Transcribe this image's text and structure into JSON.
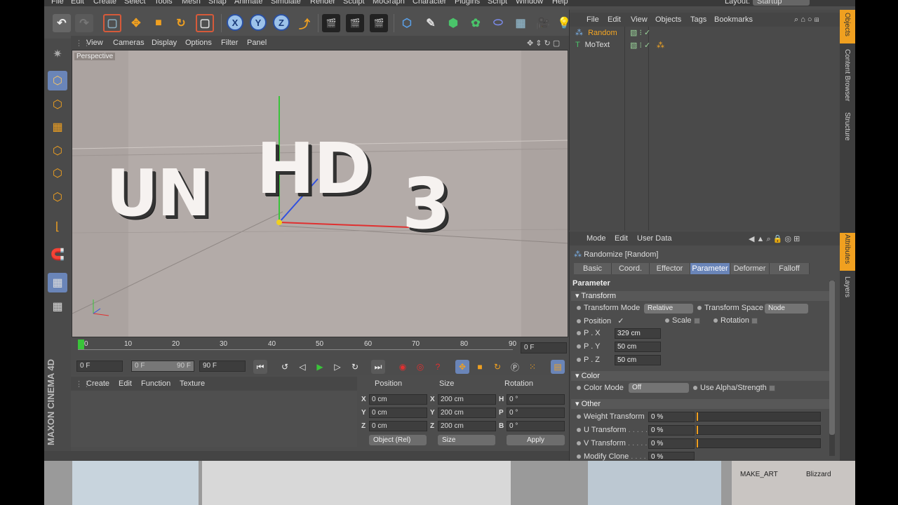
{
  "menubar": [
    "File",
    "Edit",
    "Create",
    "Select",
    "Tools",
    "Mesh",
    "Snap",
    "Animate",
    "Simulate",
    "Render",
    "Sculpt",
    "MoGraph",
    "Character",
    "Plugins",
    "Script",
    "Window",
    "Help"
  ],
  "layout": {
    "label": "Layout:",
    "value": "Startup"
  },
  "toolbar": {
    "axis_x": "X",
    "axis_y": "Y",
    "axis_z": "Z"
  },
  "viewport": {
    "menu": [
      "View",
      "Cameras",
      "Display",
      "Options",
      "Filter",
      "Panel"
    ],
    "label": "Perspective",
    "text_objects": [
      "UN",
      "HD",
      "3"
    ]
  },
  "timeline": {
    "ticks": [
      "0",
      "10",
      "20",
      "30",
      "40",
      "50",
      "60",
      "70",
      "80",
      "90"
    ],
    "current_frame": "0 F"
  },
  "transport": {
    "start_field": "0 F",
    "preview_min": "0 F",
    "preview_max": "90 F",
    "end_field": "90 F"
  },
  "material_manager": {
    "menu": [
      "Create",
      "Edit",
      "Function",
      "Texture"
    ]
  },
  "coordinates": {
    "headers": {
      "position": "Position",
      "size": "Size",
      "rotation": "Rotation"
    },
    "rows": [
      {
        "axis": "X",
        "pos": "0 cm",
        "size_axis": "X",
        "size": "200 cm",
        "rot_axis": "H",
        "rot": "0 °"
      },
      {
        "axis": "Y",
        "pos": "0 cm",
        "size_axis": "Y",
        "size": "200 cm",
        "rot_axis": "P",
        "rot": "0 °"
      },
      {
        "axis": "Z",
        "pos": "0 cm",
        "size_axis": "Z",
        "size": "200 cm",
        "rot_axis": "B",
        "rot": "0 °"
      }
    ],
    "mode_dropdown": "Object (Rel)",
    "size_dropdown": "Size",
    "apply": "Apply"
  },
  "objects": {
    "menu": [
      "File",
      "Edit",
      "View",
      "Objects",
      "Tags",
      "Bookmarks"
    ],
    "items": [
      {
        "name": "Random",
        "selected": true
      },
      {
        "name": "MoText",
        "selected": false
      }
    ]
  },
  "attributes": {
    "menu": [
      "Mode",
      "Edit",
      "User Data"
    ],
    "title": "Randomize [Random]",
    "tabs": [
      "Basic",
      "Coord.",
      "Effector",
      "Parameter",
      "Deformer",
      "Falloff"
    ],
    "active_tab": "Parameter",
    "section": "Parameter",
    "transform_head": "Transform",
    "transform_mode_label": "Transform Mode",
    "transform_mode_value": "Relative",
    "transform_space_label": "Transform Space",
    "transform_space_value": "Node",
    "position_label": "Position",
    "position_check": "✓",
    "scale_label": "Scale",
    "rotation_label": "Rotation",
    "px_label": "P . X",
    "px_value": "329 cm",
    "py_label": "P . Y",
    "py_value": "50 cm",
    "pz_label": "P . Z",
    "pz_value": "50 cm",
    "color_head": "Color",
    "color_mode_label": "Color Mode",
    "color_mode_value": "Off",
    "alpha_label": "Use Alpha/Strength",
    "other_head": "Other",
    "weight_label": "Weight Transform",
    "weight_value": "0 %",
    "u_label": "U Transform",
    "u_value": "0 %",
    "v_label": "V Transform",
    "v_value": "0 %",
    "modify_label": "Modify Clone",
    "modify_value": "0 %"
  },
  "right_tabs": [
    "Objects",
    "Content Browser",
    "Structure",
    "Attributes",
    "Layers"
  ],
  "branding": "MAXON CINEMA 4D",
  "background_labels": [
    "MAKE_ART",
    "Blizzard"
  ],
  "colors": {
    "accent": "#6a85b8",
    "selected_object": "#f5a623",
    "panel": "#4d4d4d"
  }
}
